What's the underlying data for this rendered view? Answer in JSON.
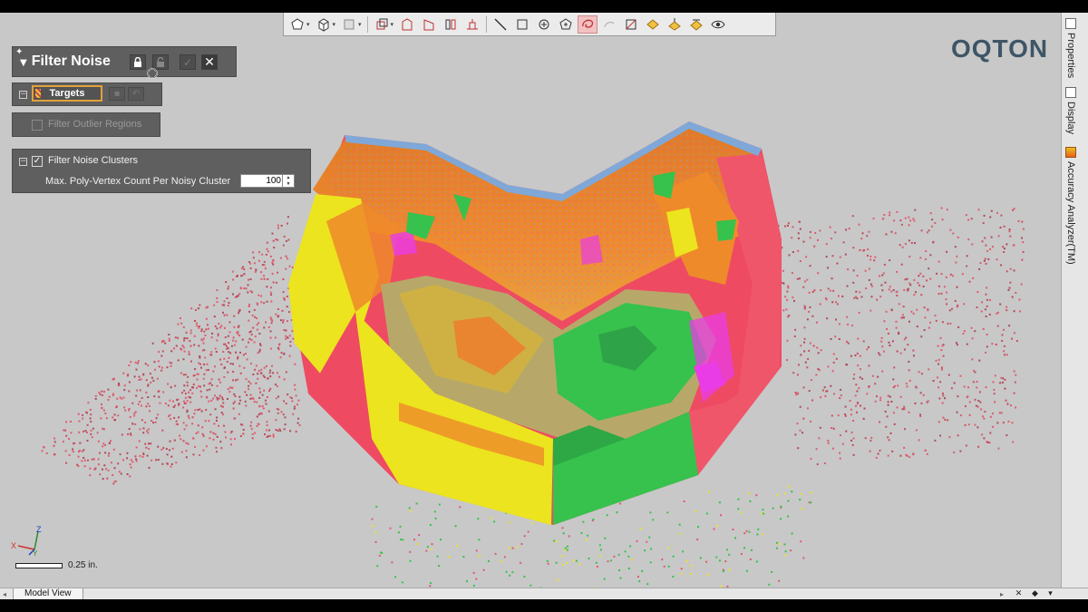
{
  "app": {
    "logo_text": "OQTON"
  },
  "toolbar": {
    "buttons": [
      {
        "name": "polygon-tool-icon",
        "has_dropdown": true
      },
      {
        "name": "box-tool-icon",
        "has_dropdown": true
      },
      {
        "name": "surface-tool-icon",
        "has_dropdown": true
      },
      {
        "name": "cube-view-icon",
        "has_dropdown": true
      },
      {
        "name": "section-view-icon"
      },
      {
        "name": "section-view-alt-icon"
      },
      {
        "name": "split-view-icon"
      },
      {
        "name": "align-icon"
      },
      {
        "name": "line-select-icon"
      },
      {
        "name": "rect-select-icon"
      },
      {
        "name": "circle-select-icon"
      },
      {
        "name": "polygon-select-icon"
      },
      {
        "name": "lasso-select-icon",
        "active": true
      },
      {
        "name": "paint-select-icon"
      },
      {
        "name": "clip-icon"
      },
      {
        "name": "invert-select-icon"
      },
      {
        "name": "grow-select-icon"
      },
      {
        "name": "shrink-select-icon"
      },
      {
        "name": "show-hide-icon"
      }
    ]
  },
  "side_dock": {
    "tabs": [
      {
        "label": "Properties"
      },
      {
        "label": "Display"
      },
      {
        "label": "Accuracy Analyzer(TM)"
      }
    ]
  },
  "panel": {
    "title": "Filter Noise",
    "targets_label": "Targets",
    "filter_outlier_label": "Filter Outlier Regions",
    "filter_outlier_checked": false,
    "noise_clusters_label": "Filter Noise Clusters",
    "noise_clusters_checked": true,
    "max_count_label": "Max. Poly-Vertex Count Per Noisy Cluster",
    "max_count_value": "100"
  },
  "triad": {
    "x": "X",
    "y": "Y",
    "z": "Z"
  },
  "scale": {
    "label": "0.25 in."
  },
  "bottom": {
    "tab_label": "Model View"
  },
  "colors": {
    "viewport_bg": "#c8c8c8",
    "panel_bg": "#5f5f5f",
    "accent_orange": "#e1a23a",
    "logo": "#3e5566",
    "scan_red": "#ee4b63",
    "scan_yellow": "#ece41e",
    "scan_green": "#36c24c",
    "scan_orange": "#ef8a2a",
    "scan_magenta": "#ea3ce6",
    "scan_blue": "#7fa8d8"
  }
}
